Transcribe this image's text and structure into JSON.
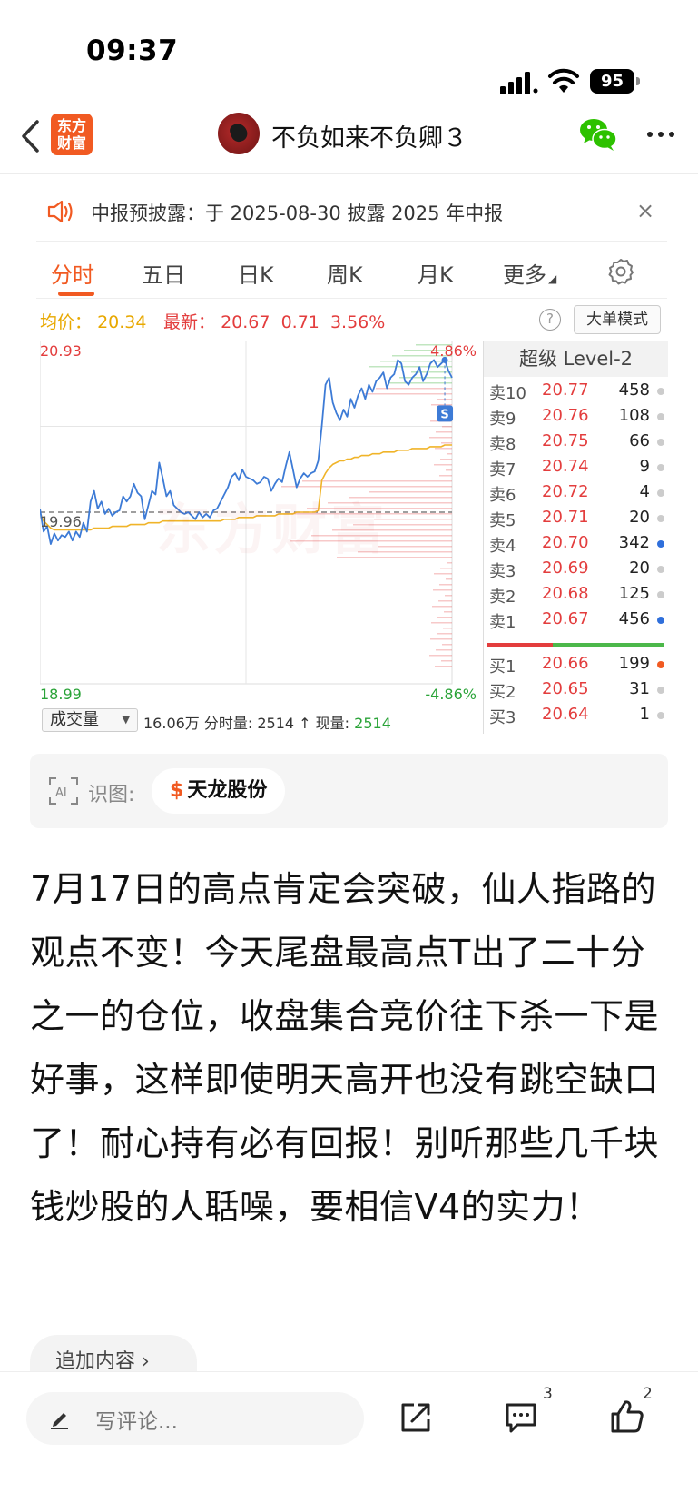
{
  "status_bar": {
    "time": "09:37",
    "battery": "95"
  },
  "nav": {
    "logo_line1": "东方",
    "logo_line2": "财富",
    "title": "不负如来不负卿３"
  },
  "notice": {
    "text": "中报预披露：于 2025-08-30 披露 2025 年中报"
  },
  "tabs": [
    {
      "label": "分时"
    },
    {
      "label": "五日"
    },
    {
      "label": "日K"
    },
    {
      "label": "周K"
    },
    {
      "label": "月K"
    },
    {
      "label": "更多"
    }
  ],
  "info": {
    "avg_label": "均价：",
    "avg_value": "20.34",
    "last_label": "最新：",
    "last_value": "20.67",
    "change": "0.71",
    "change_pct": "3.56%",
    "mode_button": "大单模式"
  },
  "chart_data": {
    "type": "line",
    "y_max": 20.93,
    "y_mid": 19.96,
    "y_min": 18.99,
    "labels": {
      "high": "20.93",
      "mid": "19.96",
      "low": "18.99",
      "pct_high": "4.86%",
      "pct_low": "-4.86%"
    },
    "series": [
      {
        "name": "price",
        "values": [
          19.98,
          19.85,
          19.88,
          19.78,
          19.84,
          19.8,
          19.83,
          19.82,
          19.85,
          19.8,
          19.85,
          19.82,
          19.9,
          19.85,
          20.02,
          20.08,
          19.98,
          20.02,
          19.95,
          19.98,
          19.94,
          19.96,
          19.97,
          20.05,
          20.02,
          20.05,
          20.12,
          20.07,
          20.05,
          19.92,
          20.0,
          20.08,
          20.06,
          20.24,
          20.15,
          20.05,
          20.08,
          20.0,
          19.98,
          19.96,
          19.95,
          19.96,
          19.94,
          19.92,
          19.96,
          19.93,
          19.95,
          19.93,
          19.97,
          19.98,
          20.02,
          20.06,
          20.1,
          20.16,
          20.18,
          20.14,
          20.2,
          20.16,
          20.15,
          20.14,
          20.12,
          20.13,
          20.16,
          20.15,
          20.08,
          20.12,
          20.15,
          20.13,
          20.22,
          20.3,
          20.2,
          20.1,
          20.15,
          20.18,
          20.16,
          20.18,
          20.19,
          20.25,
          20.45,
          20.68,
          20.72,
          20.58,
          20.52,
          20.48,
          20.54,
          20.5,
          20.6,
          20.55,
          20.62,
          20.66,
          20.6,
          20.68,
          20.64,
          20.7,
          20.72,
          20.75,
          20.66,
          20.72,
          20.74,
          20.82,
          20.8,
          20.7,
          20.68,
          20.72,
          20.74,
          20.78,
          20.7,
          20.74,
          20.8,
          20.82,
          20.78,
          20.8,
          20.82,
          20.76,
          20.72
        ],
        "color": "#3d7bd6"
      },
      {
        "name": "avg",
        "values": [
          19.96,
          19.91,
          19.89,
          19.87,
          19.86,
          19.86,
          19.86,
          19.86,
          19.86,
          19.86,
          19.86,
          19.86,
          19.86,
          19.86,
          19.86,
          19.87,
          19.87,
          19.87,
          19.87,
          19.87,
          19.88,
          19.88,
          19.88,
          19.88,
          19.88,
          19.89,
          19.89,
          19.89,
          19.89,
          19.89,
          19.9,
          19.9,
          19.9,
          19.9,
          19.91,
          19.91,
          19.91,
          19.91,
          19.91,
          19.91,
          19.91,
          19.91,
          19.91,
          19.91,
          19.91,
          19.91,
          19.91,
          19.91,
          19.91,
          19.91,
          19.91,
          19.92,
          19.92,
          19.92,
          19.92,
          19.93,
          19.93,
          19.93,
          19.93,
          19.93,
          19.94,
          19.94,
          19.94,
          19.94,
          19.94,
          19.94,
          19.95,
          19.95,
          19.95,
          19.95,
          19.95,
          19.96,
          19.96,
          19.96,
          19.96,
          19.96,
          19.96,
          19.97,
          20.14,
          20.18,
          20.21,
          20.23,
          20.24,
          20.25,
          20.25,
          20.26,
          20.26,
          20.27,
          20.27,
          20.28,
          20.28,
          20.28,
          20.29,
          20.29,
          20.29,
          20.3,
          20.3,
          20.3,
          20.3,
          20.31,
          20.31,
          20.31,
          20.31,
          20.32,
          20.32,
          20.32,
          20.32,
          20.32,
          20.33,
          20.33,
          20.33,
          20.33,
          20.34,
          20.34,
          20.34
        ],
        "color": "#f0b429"
      }
    ]
  },
  "volume": {
    "select_label": "成交量",
    "text": "16.06万 分时量: 2514 ↑ 现量: ",
    "now_value": "2514"
  },
  "order_book": {
    "title": "超级 Level-2",
    "asks": [
      {
        "label": "卖10",
        "price": "20.77",
        "vol": "458",
        "dot": "grey"
      },
      {
        "label": "卖9",
        "price": "20.76",
        "vol": "108",
        "dot": "grey"
      },
      {
        "label": "卖8",
        "price": "20.75",
        "vol": "66",
        "dot": "grey"
      },
      {
        "label": "卖7",
        "price": "20.74",
        "vol": "9",
        "dot": "grey"
      },
      {
        "label": "卖6",
        "price": "20.72",
        "vol": "4",
        "dot": "grey"
      },
      {
        "label": "卖5",
        "price": "20.71",
        "vol": "20",
        "dot": "grey"
      },
      {
        "label": "卖4",
        "price": "20.70",
        "vol": "342",
        "dot": "blue"
      },
      {
        "label": "卖3",
        "price": "20.69",
        "vol": "20",
        "dot": "grey"
      },
      {
        "label": "卖2",
        "price": "20.68",
        "vol": "125",
        "dot": "grey"
      },
      {
        "label": "卖1",
        "price": "20.67",
        "vol": "456",
        "dot": "blue"
      }
    ],
    "bids": [
      {
        "label": "买1",
        "price": "20.66",
        "vol": "199",
        "dot": "orange"
      },
      {
        "label": "买2",
        "price": "20.65",
        "vol": "31",
        "dot": "grey"
      },
      {
        "label": "买3",
        "price": "20.64",
        "vol": "1",
        "dot": "grey"
      }
    ]
  },
  "ai": {
    "label": "识图:",
    "stock": "天龙股份"
  },
  "post": {
    "text": "7月17日的高点肯定会突破，仙人指路的观点不变！今天尾盘最高点T出了二十分之一的仓位，收盘集合竞价往下杀一下是好事，这样即使明天高开也没有跳空缺口了！耐心持有必有回报！别听那些几千块钱炒股的人聒噪，要相信V4的实力！"
  },
  "add_content": "追加内容",
  "bottom": {
    "comment_placeholder": "写评论...",
    "comment_count": "3",
    "like_count": "2"
  }
}
